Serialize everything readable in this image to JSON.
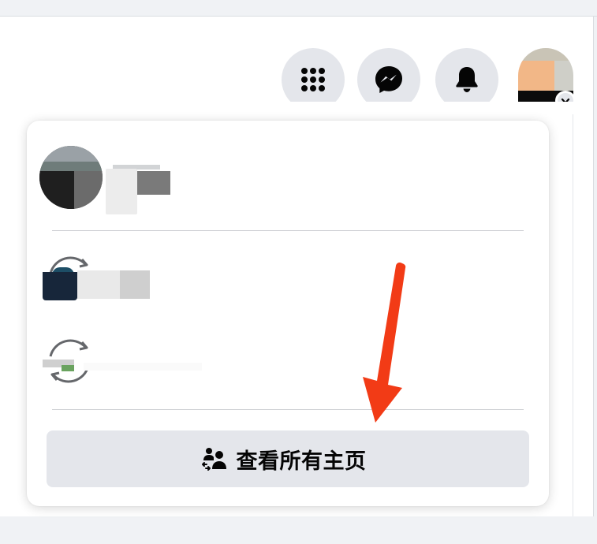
{
  "header": {
    "menu_icon": "grid-menu-icon",
    "messenger_icon": "messenger-icon",
    "notifications_icon": "bell-icon",
    "account_chevron_icon": "chevron-down-icon"
  },
  "dropdown": {
    "see_all_label": "查看所有主页",
    "see_all_icon": "pages-people-icon",
    "switch_icon": "switch-profile-icon"
  },
  "colors": {
    "button_bg": "#e4e6eb",
    "text": "#050505",
    "divider": "#ced0d4",
    "annotation_arrow": "#f23b16"
  }
}
